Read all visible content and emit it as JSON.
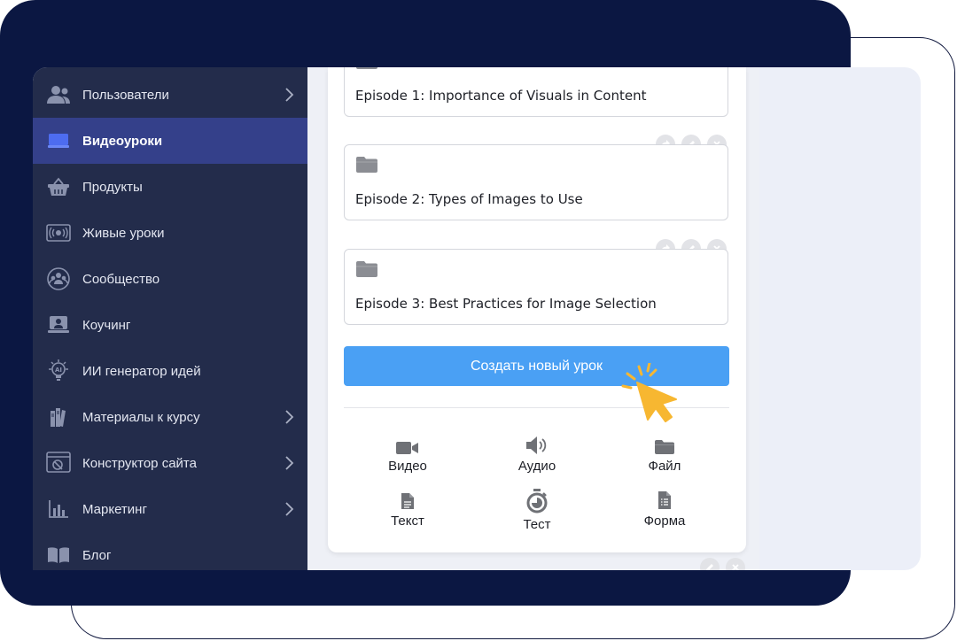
{
  "sidebar": {
    "items": [
      {
        "label": "Пользователи",
        "icon": "users-icon",
        "has_submenu": true,
        "active": false
      },
      {
        "label": "Видеоуроки",
        "icon": "video-lessons-icon",
        "has_submenu": false,
        "active": true
      },
      {
        "label": "Продукты",
        "icon": "basket-icon",
        "has_submenu": false,
        "active": false
      },
      {
        "label": "Живые уроки",
        "icon": "live-stream-icon",
        "has_submenu": false,
        "active": false
      },
      {
        "label": "Сообщество",
        "icon": "community-icon",
        "has_submenu": false,
        "active": false
      },
      {
        "label": "Коучинг",
        "icon": "coaching-icon",
        "has_submenu": false,
        "active": false
      },
      {
        "label": "ИИ генератор идей",
        "icon": "ai-bulb-icon",
        "has_submenu": false,
        "active": false
      },
      {
        "label": "Материалы к курсу",
        "icon": "materials-icon",
        "has_submenu": true,
        "active": false
      },
      {
        "label": "Конструктор сайта",
        "icon": "site-builder-icon",
        "has_submenu": true,
        "active": false
      },
      {
        "label": "Маркетинг",
        "icon": "chart-icon",
        "has_submenu": true,
        "active": false
      },
      {
        "label": "Блог",
        "icon": "book-icon",
        "has_submenu": false,
        "active": false
      }
    ]
  },
  "episodes": [
    {
      "title": "Episode 1: Importance of Visuals in Content"
    },
    {
      "title": "Episode 2: Types of Images to Use"
    },
    {
      "title": "Episode 3: Best Practices for Image Selection"
    }
  ],
  "create_button": {
    "label": "Создать новый урок"
  },
  "lesson_types": [
    {
      "label": "Видео",
      "icon": "video-camera-icon"
    },
    {
      "label": "Аудио",
      "icon": "speaker-icon"
    },
    {
      "label": "Файл",
      "icon": "folder-icon"
    },
    {
      "label": "Текст",
      "icon": "text-document-icon"
    },
    {
      "label": "Тест",
      "icon": "stopwatch-icon"
    },
    {
      "label": "Форма",
      "icon": "form-document-icon"
    }
  ],
  "colors": {
    "frame_navy": "#0b1742",
    "sidebar_bg": "#232c4b",
    "sidebar_active": "#34408a",
    "primary_button": "#4aa0f4",
    "cursor_accent": "#f7b731"
  }
}
